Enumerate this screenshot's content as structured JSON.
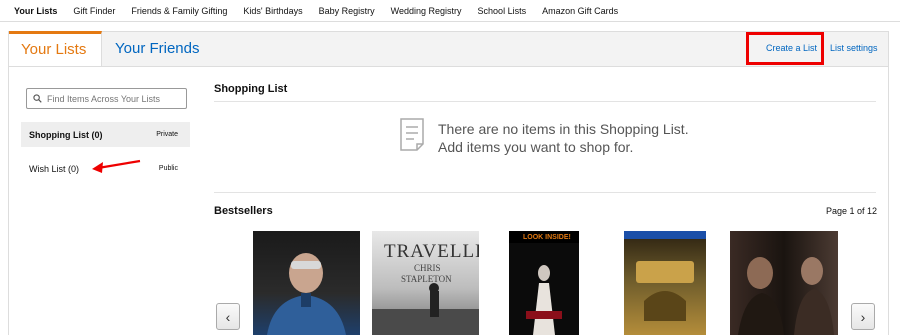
{
  "topnav": {
    "items": [
      "Your Lists",
      "Gift Finder",
      "Friends & Family Gifting",
      "Kids' Birthdays",
      "Baby Registry",
      "Wedding Registry",
      "School Lists",
      "Amazon Gift Cards"
    ]
  },
  "tabs": {
    "active": "Your Lists",
    "friends": "Your Friends",
    "create": "Create a List",
    "settings": "List settings"
  },
  "sidebar": {
    "search_placeholder": "Find Items Across Your Lists",
    "lists": [
      {
        "name": "Shopping List (0)",
        "privacy": "Private"
      },
      {
        "name": "Wish List (0)",
        "privacy": "Public"
      }
    ]
  },
  "main": {
    "list_title": "Shopping List",
    "empty_line1": "There are no items in this Shopping List.",
    "empty_line2": "Add items you want to shop for.",
    "bestsellers_title": "Bestsellers",
    "page_indicator": "Page 1 of 12"
  },
  "books": {
    "b2_title": "TRAVELLER",
    "b2_author1": "CHRIS",
    "b2_author2": "STAPLETON",
    "b3_badge": "LOOK INSIDE!"
  },
  "colors": {
    "accent": "#e47911",
    "link": "#0066c0",
    "highlight_box": "#e00000"
  }
}
